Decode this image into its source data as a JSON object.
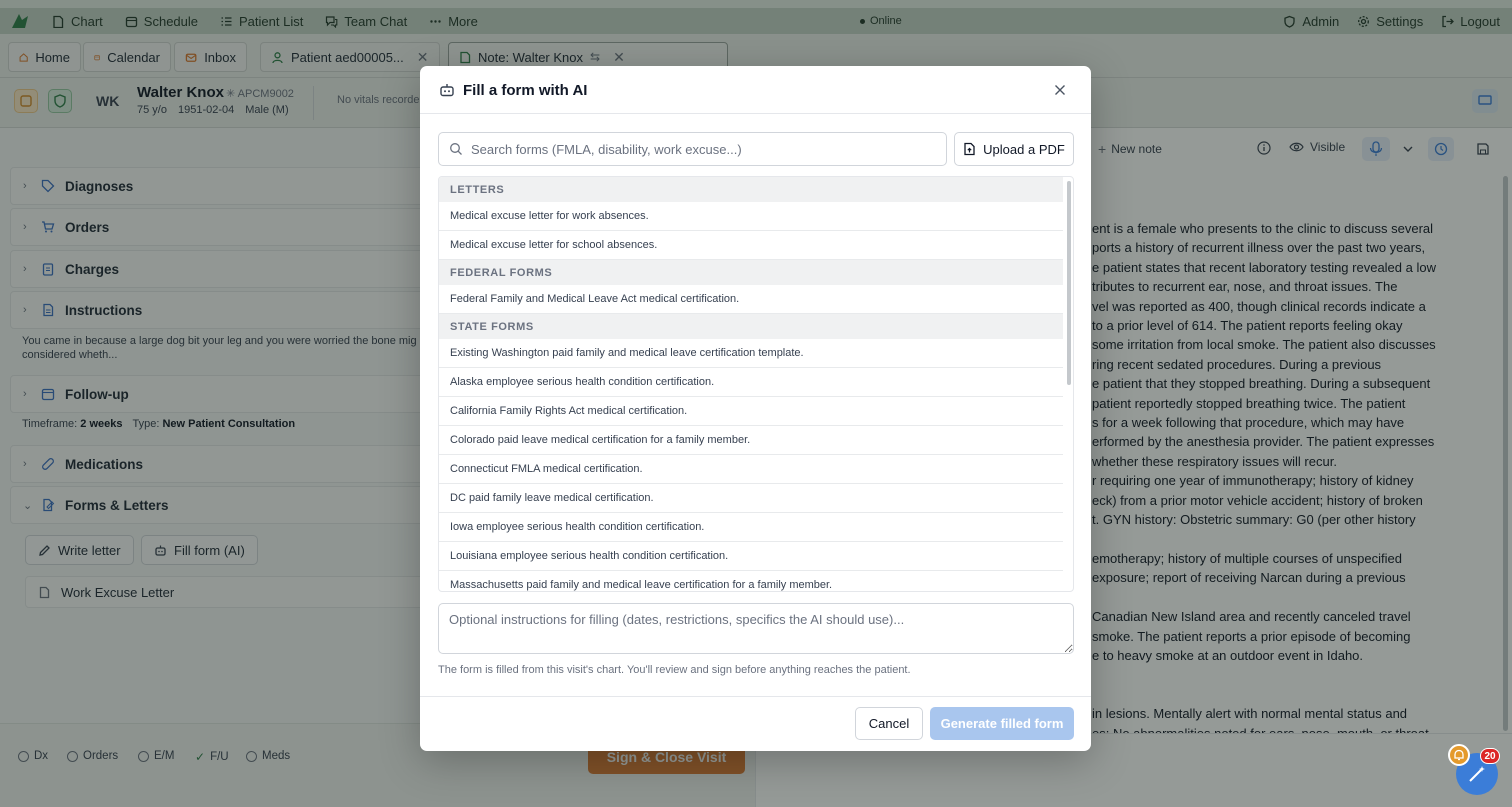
{
  "topnav": {
    "items": [
      {
        "label": "Chart",
        "icon": "chart-icon"
      },
      {
        "label": "Schedule",
        "icon": "calendar-icon"
      },
      {
        "label": "Patient List",
        "icon": "list-icon"
      },
      {
        "label": "Team Chat",
        "icon": "chat-icon"
      },
      {
        "label": "More",
        "icon": "dots-icon"
      }
    ],
    "status": "Online",
    "right": [
      {
        "label": "Admin",
        "icon": "shield-icon"
      },
      {
        "label": "Settings",
        "icon": "gear-icon"
      },
      {
        "label": "Logout",
        "icon": "logout-icon"
      }
    ]
  },
  "tabs": {
    "home": "Home",
    "calendar": "Calendar",
    "inbox": "Inbox",
    "patient": "Patient aed00005...",
    "note": "Note: Walter Knox"
  },
  "patient": {
    "initials": "WK",
    "name": "Walter Knox",
    "id": "APCM9002",
    "age": "75 y/o",
    "dob": "1951-02-04",
    "sex": "Male (M)",
    "vitals": "No vitals recorde"
  },
  "sections": {
    "diagnoses": "Diagnoses",
    "orders": "Orders",
    "charges": "Charges",
    "instructions": "Instructions",
    "instructions_text_1": "You came in because a large dog bit your leg and you were worried the bone mig",
    "instructions_text_2": "considered wheth...",
    "followup": "Follow-up",
    "followup_timeframe_label": "Timeframe:",
    "followup_timeframe": "2 weeks",
    "followup_type_label": "Type:",
    "followup_type": "New Patient Consultation",
    "medications": "Medications",
    "forms": "Forms & Letters",
    "write_letter": "Write letter",
    "fill_form": "Fill form (AI)",
    "letter_item": "Work Excuse Letter"
  },
  "bottom": {
    "checks": [
      "Dx",
      "Orders",
      "E/M",
      "F/U",
      "Meds"
    ],
    "fu_checked": "✓",
    "sign": "Sign & Close Visit"
  },
  "note_toolbar": {
    "new_note": "New note",
    "visibility": "Visible"
  },
  "note_text": [
    "ent is a female who presents to the clinic to discuss several",
    "ports a history of recurrent illness over the past two years,",
    "e patient states that recent laboratory testing revealed a low",
    "tributes to recurrent ear, nose, and throat issues. The",
    "vel was reported as 400, though clinical records indicate a",
    " to a prior level of 614. The patient reports feeling okay",
    "some irritation from local smoke. The patient also discusses",
    "ring recent sedated procedures. During a previous",
    "e patient that they stopped breathing. During a subsequent",
    " patient reportedly stopped breathing twice. The patient",
    "s for a week following that procedure, which may have",
    "erformed by the anesthesia provider. The patient expresses",
    "whether these respiratory issues will recur.",
    "r requiring one year of immunotherapy; history of kidney",
    "eck) from a prior motor vehicle accident; history of broken",
    "t. GYN history: Obstetric summary: G0 (per other history",
    "",
    "emotherapy; history of multiple courses of unspecified",
    "exposure; report of receiving Narcan during a previous",
    "",
    "Canadian New Island area and recently canceled travel",
    "smoke. The patient reports a prior episode of becoming",
    "e to heavy smoke at an outdoor event in Idaho.",
    "",
    "",
    "in lesions. Mentally alert with normal mental status and",
    "es: No abnormalities noted for ears, nose, mouth, or throat."
  ],
  "modal": {
    "title": "Fill a form with AI",
    "search_placeholder": "Search forms (FMLA, disability, work excuse...)",
    "upload": "Upload a PDF",
    "groups": [
      {
        "label": "LETTERS",
        "items": [
          "Medical excuse letter for work absences.",
          "Medical excuse letter for school absences."
        ]
      },
      {
        "label": "FEDERAL FORMS",
        "items": [
          "Federal Family and Medical Leave Act medical certification."
        ]
      },
      {
        "label": "STATE FORMS",
        "items": [
          "Existing Washington paid family and medical leave certification template.",
          "Alaska employee serious health condition certification.",
          "California Family Rights Act medical certification.",
          "Colorado paid leave medical certification for a family member.",
          "Connecticut FMLA medical certification.",
          "DC paid family leave medical certification.",
          "Iowa employee serious health condition certification.",
          "Louisiana employee serious health condition certification.",
          "Massachusetts paid family and medical leave certification for a family member."
        ]
      }
    ],
    "instructions_placeholder": "Optional instructions for filling (dates, restrictions, specifics the AI should use)...",
    "note": "The form is filled from this visit's chart. You'll review and sign before anything reaches the patient.",
    "cancel": "Cancel",
    "generate": "Generate filled form"
  },
  "notifications": {
    "count": "20"
  },
  "colors": {
    "accent": "#3b7dd8",
    "sign": "#d97b36",
    "generate_disabled": "#a9c6ee",
    "brand_green": "#2f7d4a"
  }
}
